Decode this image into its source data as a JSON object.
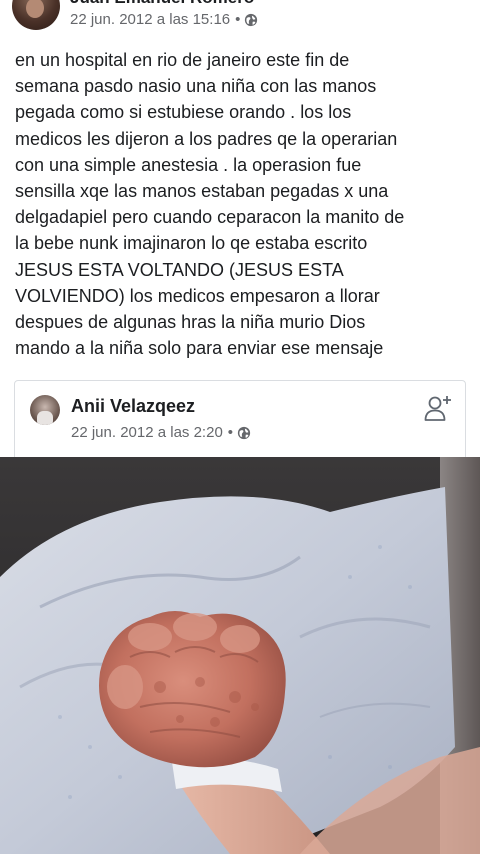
{
  "post": {
    "author": "Juan Emanuel Romero",
    "date": "22 jun. 2012 a las 15:16",
    "separator": "•",
    "privacy_icon": "globe-icon",
    "text_lines": [
      "en un hospital en rio de janeiro este fin de",
      "semana pasdo nasio una niña con las manos",
      "pegada como si estubiese orando . los los",
      "medicos les dijeron a los padres qe la operarian",
      "con una simple anestesia . la operasion  fue",
      "sensilla xqe las manos estaban pegadas x una",
      "delgadapiel pero cuando ceparacon la manito de",
      "la bebe nunk imajinaron  lo qe estaba escrito",
      "JESUS ESTA VOLTANDO (JESUS ESTA",
      "VOLVIENDO) los medicos empesaron a llorar",
      "despues de algunas hras la niña murio Dios",
      "mando a la niña solo para enviar ese mensaje"
    ]
  },
  "shared": {
    "author": "Anii Velazqeez",
    "date": "22 jun. 2012 a las 2:20",
    "separator": "•",
    "privacy_icon": "globe-icon",
    "action_icon": "add-friend-icon"
  },
  "photo": {
    "subject": "baby-hand-photo"
  },
  "colors": {
    "text": "#1c1e21",
    "meta": "#65676b",
    "card_border": "#dadde1"
  }
}
